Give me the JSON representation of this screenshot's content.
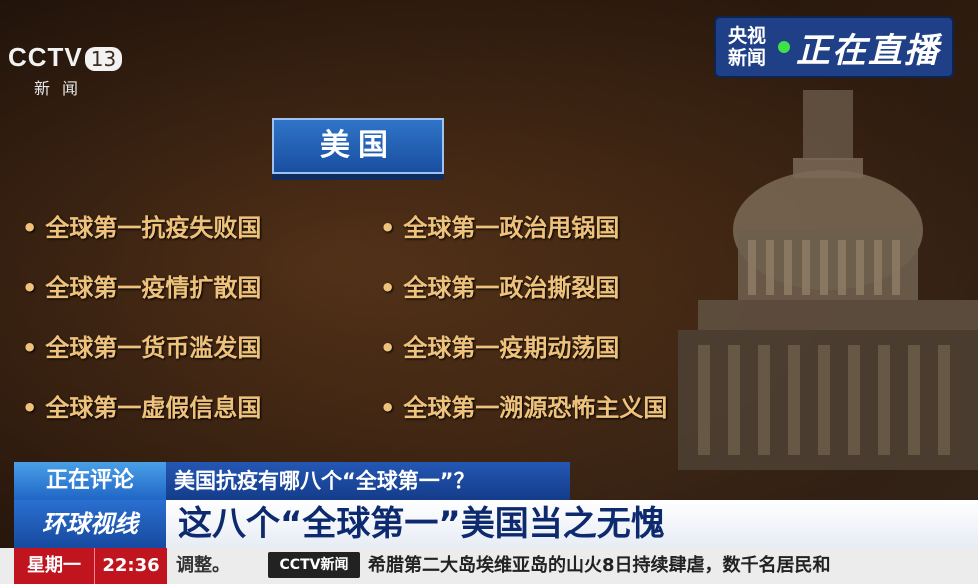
{
  "channel": {
    "logo_main": "CCTV",
    "logo_num": "13",
    "logo_sub": "新闻"
  },
  "live_badge": {
    "source": "央视新闻",
    "label": "正在直播"
  },
  "country_tag": "美国",
  "items_left": [
    "全球第一抗疫失败国",
    "全球第一疫情扩散国",
    "全球第一货币滥发国",
    "全球第一虚假信息国"
  ],
  "items_right": [
    "全球第一政治甩锅国",
    "全球第一政治撕裂国",
    "全球第一疫期动荡国",
    "全球第一溯源恐怖主义国"
  ],
  "lower_third": {
    "tag": "正在评论",
    "topic": "美国抗疫有哪八个“全球第一”？",
    "show": "环球视线",
    "headline": "这八个“全球第一”美国当之无愧"
  },
  "ticker": {
    "weekday": "星期一",
    "time": "22:36",
    "lead_text": "调整。",
    "logo": "CCTV新闻",
    "text": "希腊第二大岛埃维亚岛的山火8日持续肆虐，数千名居民和"
  },
  "colors": {
    "accent_gold": "#efc27c",
    "brand_blue": "#1f3f86",
    "live_green": "#3fe14a",
    "time_red": "#c0141e"
  }
}
